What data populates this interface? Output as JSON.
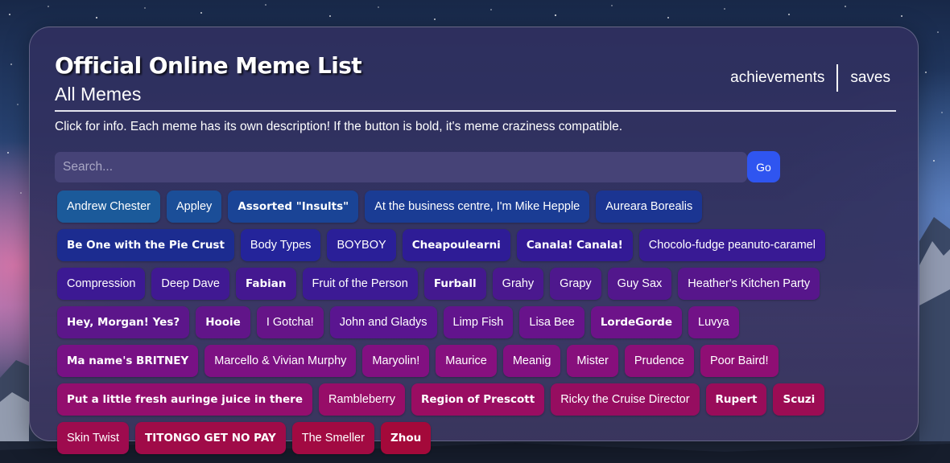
{
  "header": {
    "title": "Official Online Meme List",
    "subtitle": "All Memes"
  },
  "nav": {
    "achievements_label": "achievements",
    "saves_label": "saves"
  },
  "intro_text": "Click for info. Each meme has its own description! If the button is bold, it's meme craziness compatible.",
  "search": {
    "placeholder": "Search...",
    "value": "",
    "go_label": "Go"
  },
  "memes": [
    {
      "label": "Andrew Chester",
      "bold": false,
      "color": "#1b5a9a"
    },
    {
      "label": "Appley",
      "bold": false,
      "color": "#1b4e98"
    },
    {
      "label": "Assorted \"Insults\"",
      "bold": true,
      "color": "#1a4496"
    },
    {
      "label": "At the business centre, I'm Mike Hepple",
      "bold": false,
      "color": "#1a3c94"
    },
    {
      "label": "Aureara Borealis",
      "bold": false,
      "color": "#1b3592"
    },
    {
      "label": "Be One with the Pie Crust",
      "bold": true,
      "color": "#1c2c90"
    },
    {
      "label": "Body Types",
      "bold": false,
      "color": "#24249a"
    },
    {
      "label": "BOYBOY",
      "bold": false,
      "color": "#2a1f98"
    },
    {
      "label": "Cheapoulearni",
      "bold": true,
      "color": "#2e1c96"
    },
    {
      "label": "Canala! Canala!",
      "bold": true,
      "color": "#331a95"
    },
    {
      "label": "Chocolo-fudge peanuto-caramel",
      "bold": false,
      "color": "#381a94"
    },
    {
      "label": "Compression",
      "bold": false,
      "color": "#3c1993"
    },
    {
      "label": "Deep Dave",
      "bold": false,
      "color": "#401992"
    },
    {
      "label": "Fabian",
      "bold": true,
      "color": "#441890"
    },
    {
      "label": "Fruit of the Person",
      "bold": false,
      "color": "#3c1a94"
    },
    {
      "label": "Furball",
      "bold": true,
      "color": "#44198f"
    },
    {
      "label": "Grahy",
      "bold": false,
      "color": "#4a188e"
    },
    {
      "label": "Grapy",
      "bold": false,
      "color": "#4e188d"
    },
    {
      "label": "Guy Sax",
      "bold": false,
      "color": "#52178c"
    },
    {
      "label": "Heather's Kitchen Party",
      "bold": false,
      "color": "#57168b"
    },
    {
      "label": "Hey, Morgan! Yes?",
      "bold": true,
      "color": "#5c168a"
    },
    {
      "label": "Hooie",
      "bold": true,
      "color": "#611589"
    },
    {
      "label": "I Gotcha!",
      "bold": false,
      "color": "#661488"
    },
    {
      "label": "John and Gladys",
      "bold": false,
      "color": "#5a1590"
    },
    {
      "label": "Limp Fish",
      "bold": false,
      "color": "#62148d"
    },
    {
      "label": "Lisa Bee",
      "bold": false,
      "color": "#68138b"
    },
    {
      "label": "LordeGorde",
      "bold": true,
      "color": "#6d1389"
    },
    {
      "label": "Luvya",
      "bold": false,
      "color": "#721287"
    },
    {
      "label": "Ma name's BRITNEY",
      "bold": true,
      "color": "#781185"
    },
    {
      "label": "Marcello & Vivian Murphy",
      "bold": false,
      "color": "#7d1183"
    },
    {
      "label": "Maryolin!",
      "bold": false,
      "color": "#821081"
    },
    {
      "label": "Maurice",
      "bold": false,
      "color": "#87107f"
    },
    {
      "label": "Meanig",
      "bold": false,
      "color": "#821080"
    },
    {
      "label": "Mister",
      "bold": false,
      "color": "#870f7c"
    },
    {
      "label": "Prudence",
      "bold": false,
      "color": "#8b0f78"
    },
    {
      "label": "Poor Baird!",
      "bold": false,
      "color": "#8f0e74"
    },
    {
      "label": "Put a little fresh auringe juice in there",
      "bold": true,
      "color": "#930e6e"
    },
    {
      "label": "Rambleberry",
      "bold": false,
      "color": "#970d68"
    },
    {
      "label": "Region of Prescott",
      "bold": true,
      "color": "#9a0d62"
    },
    {
      "label": "Ricky the Cruise Director",
      "bold": false,
      "color": "#960d60"
    },
    {
      "label": "Rupert",
      "bold": true,
      "color": "#990c5a"
    },
    {
      "label": "Scuzi",
      "bold": true,
      "color": "#9c0c54"
    },
    {
      "label": "Skin Twist",
      "bold": false,
      "color": "#9e0b4e"
    },
    {
      "label": "TITONGO GET NO PAY",
      "bold": true,
      "color": "#a00b48"
    },
    {
      "label": "The Smeller",
      "bold": false,
      "color": "#a20a42"
    },
    {
      "label": "Zhou",
      "bold": true,
      "color": "#a4093a"
    }
  ]
}
